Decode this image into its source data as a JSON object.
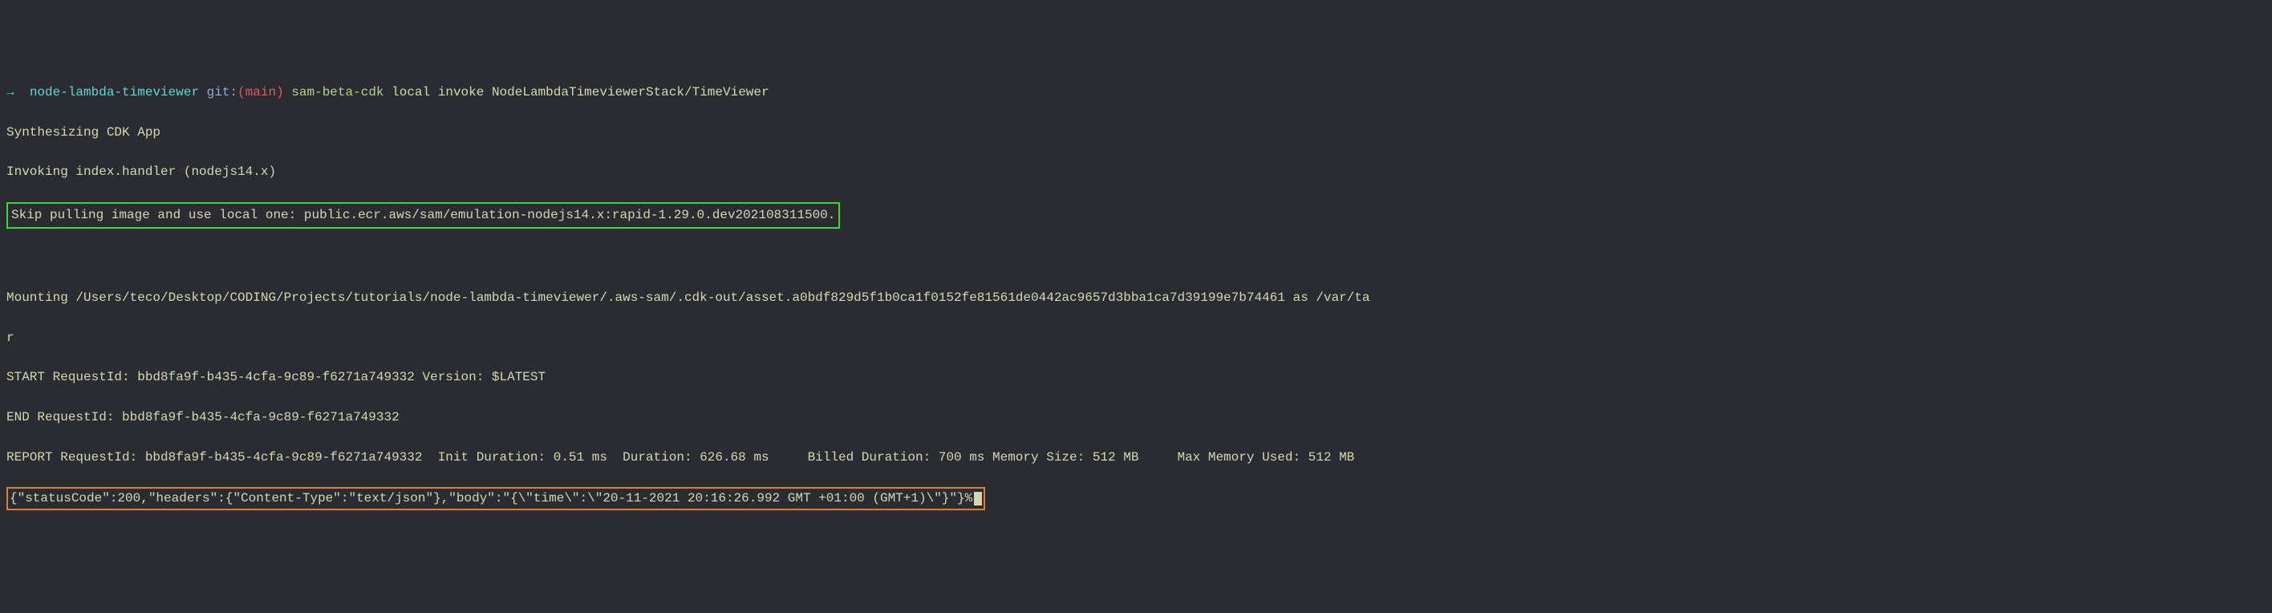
{
  "prompt": {
    "arrow": "→",
    "path": "node-lambda-timeviewer",
    "git_label": "git:",
    "paren_open": "(",
    "branch": "main",
    "paren_close": ")",
    "command": "sam-beta-cdk",
    "args": "local invoke NodeLambdaTimeviewerStack/TimeViewer"
  },
  "lines": {
    "l1": "Synthesizing CDK App",
    "l2": "Invoking index.handler (nodejs14.x)",
    "l3_boxed": "Skip pulling image and use local one: public.ecr.aws/sam/emulation-nodejs14.x:rapid-1.29.0.dev202108311500.",
    "l4": "",
    "l5": "Mounting /Users/teco/Desktop/CODING/Projects/tutorials/node-lambda-timeviewer/.aws-sam/.cdk-out/asset.a0bdf829d5f1b0ca1f0152fe81561de0442ac9657d3bba1ca7d39199e7b74461 as /var/ta",
    "l6": "r",
    "l7": "START RequestId: bbd8fa9f-b435-4cfa-9c89-f6271a749332 Version: $LATEST",
    "l8": "END RequestId: bbd8fa9f-b435-4cfa-9c89-f6271a749332",
    "l9": "REPORT RequestId: bbd8fa9f-b435-4cfa-9c89-f6271a749332  Init Duration: 0.51 ms  Duration: 626.68 ms     Billed Duration: 700 ms Memory Size: 512 MB     Max Memory Used: 512 MB",
    "l10_boxed": "{\"statusCode\":200,\"headers\":{\"Content-Type\":\"text/json\"},\"body\":\"{\\\"time\\\":\\\"20-11-2021 20:16:26.992 GMT +01:00 (GMT+1)\\\"}\"}%"
  }
}
